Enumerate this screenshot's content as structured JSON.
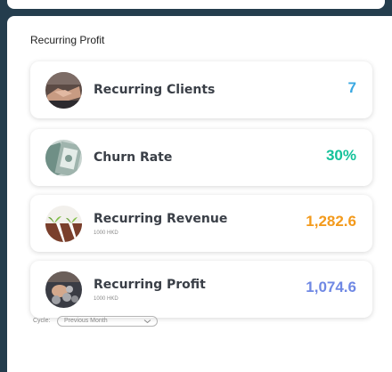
{
  "panel": {
    "title": "Recurring Profit"
  },
  "metrics": [
    {
      "label": "Recurring Clients",
      "sub": "",
      "value": "7",
      "color": "#3aa8e2",
      "icon": "handshake-icon"
    },
    {
      "label": "Churn Rate",
      "sub": "",
      "value": "30%",
      "color": "#14c29a",
      "icon": "money-stack-icon"
    },
    {
      "label": "Recurring Revenue",
      "sub": "1000 HKD",
      "value": "1,282.6",
      "color": "#f39a1c",
      "icon": "seedling-icon"
    },
    {
      "label": "Recurring Profit",
      "sub": "1000 HKD",
      "value": "1,074.6",
      "color": "#6f88e4",
      "icon": "coins-hand-icon"
    }
  ],
  "cycle": {
    "label": "Cycle:",
    "value": "Previous Month"
  }
}
